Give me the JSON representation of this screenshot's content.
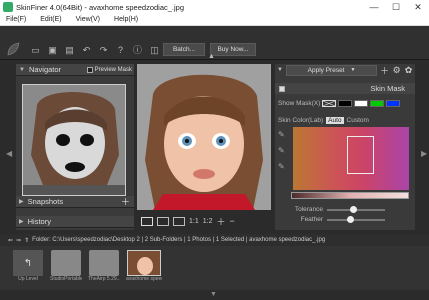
{
  "window": {
    "title": "SkinFiner 4.0(64Bit) - avaxhome speedzodiac_.jpg",
    "controls": [
      "—",
      "☐",
      "✕"
    ]
  },
  "menu": [
    "File(F)",
    "Edit(E)",
    "View(V)",
    "Help(H)"
  ],
  "toolbar": {
    "batch_label": "Batch...",
    "buynow_label": "Buy Now..."
  },
  "navigator": {
    "title": "Navigator",
    "preview_mask_label": "Preview Mask"
  },
  "snapshots": {
    "title": "Snapshots"
  },
  "history": {
    "title": "History"
  },
  "zoom": {
    "fit_label": "1:1",
    "zoom_label": "1:2"
  },
  "right_panel": {
    "apply_preset_label": "Apply Preset",
    "skin_mask_title": "Skin Mask",
    "show_mask_label": "Show Mask(X)",
    "skin_color_label": "Skin Color(Lab)",
    "auto_label": "Auto",
    "custom_label": "Custom",
    "tolerance_label": "Tolerance",
    "feather_label": "Feather",
    "tolerance_value": 0.45,
    "feather_value": 0.4,
    "mask_colors": [
      "#ffffff",
      "#000000",
      "#ffffff",
      "#00cc00",
      "#0033ff"
    ]
  },
  "folder": {
    "path": "Folder: C:\\Users\\speedzodiac\\Desktop 2 | 2 Sub-Folders | 1 Photos | 1 Selected | avaxhome speedzodiac_.jpg"
  },
  "files": [
    {
      "label": "Up Level",
      "type": "up"
    },
    {
      "label": "StudioPortable",
      "type": "folder"
    },
    {
      "label": "TheAirp 5.29...",
      "type": "folder"
    },
    {
      "label": "avaxhome speedzodiac_.jpg",
      "type": "photo"
    }
  ]
}
